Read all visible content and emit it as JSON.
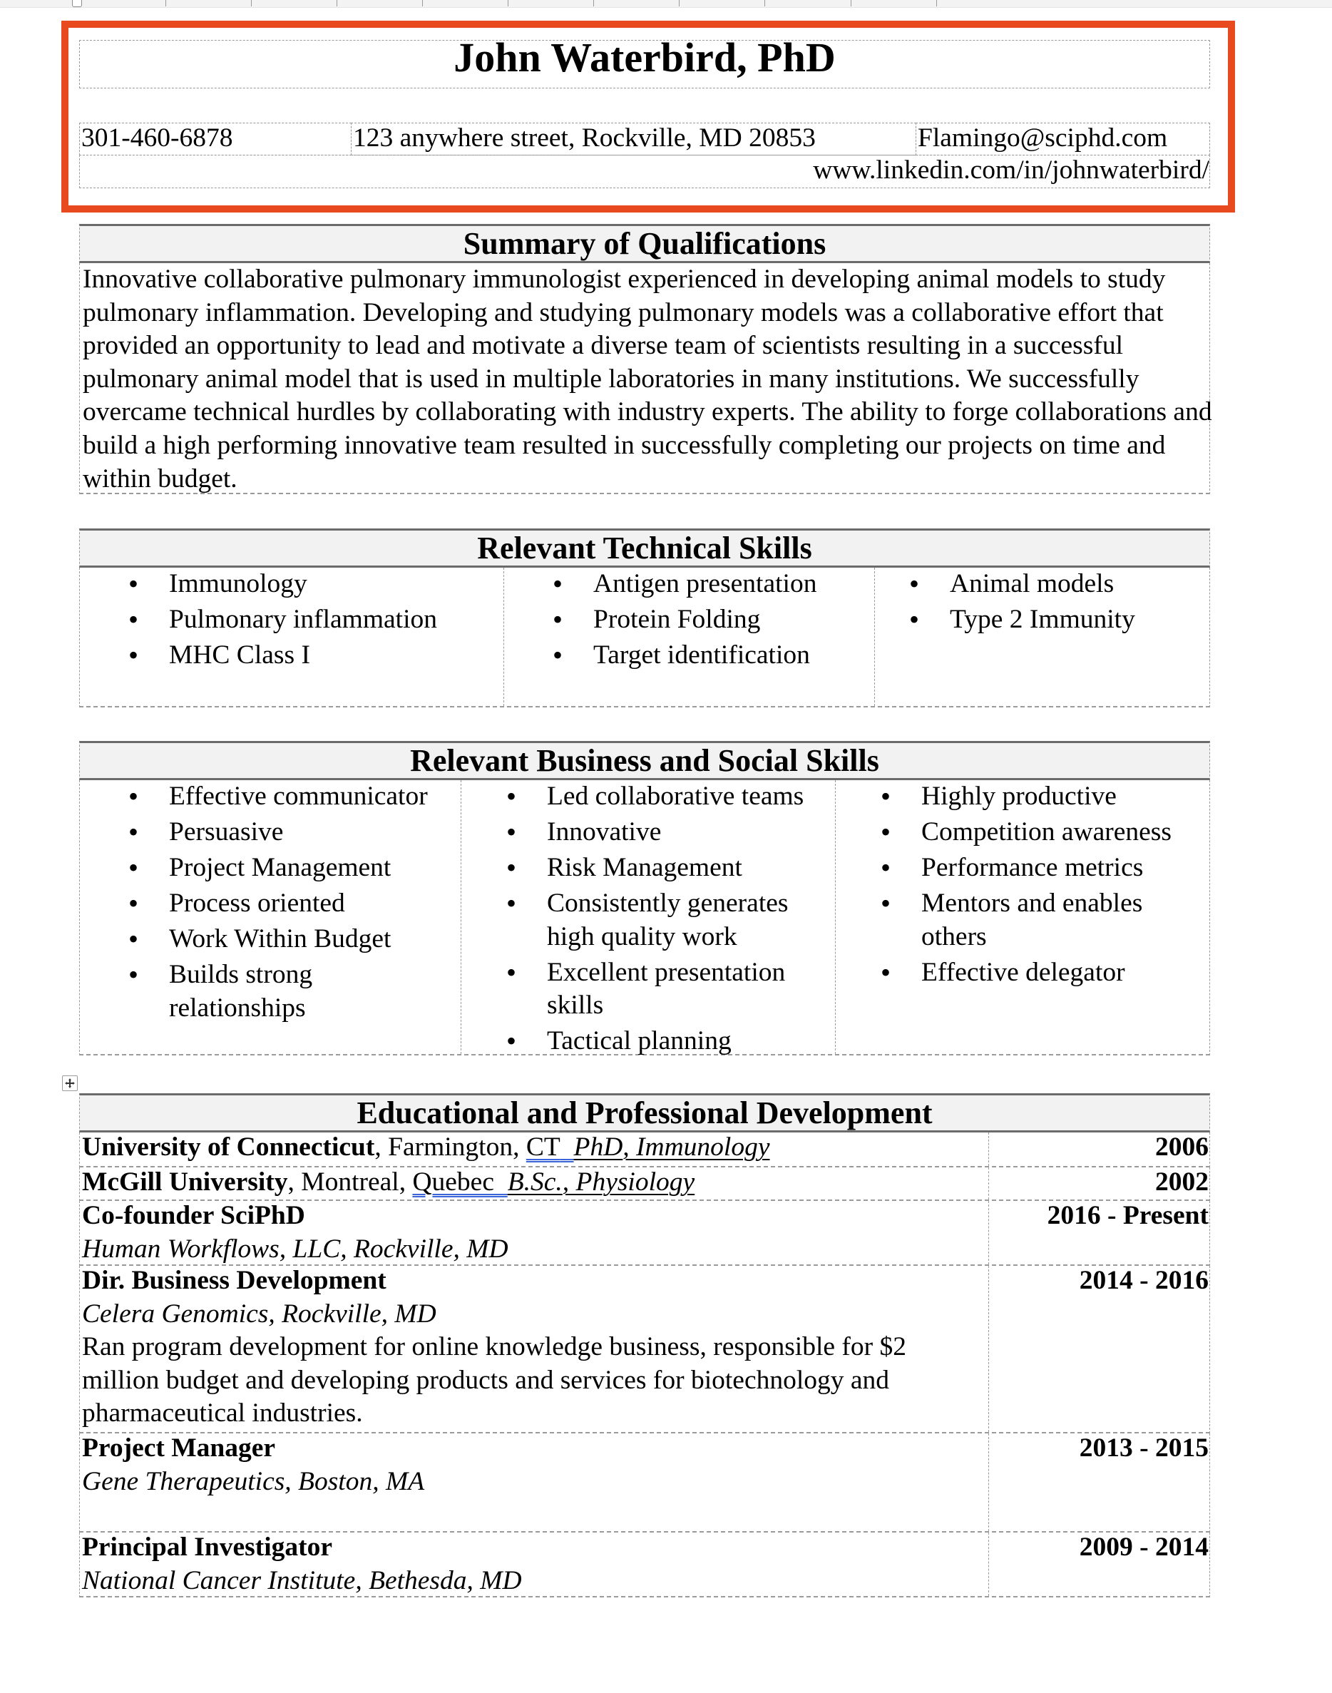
{
  "header": {
    "name": "John Waterbird, PhD",
    "phone": "301-460-6878",
    "address": "123 anywhere street, Rockville, MD 20853",
    "email": "Flamingo@sciphd.com",
    "linkedin": "www.linkedin.com/in/johnwaterbird/"
  },
  "highlight": {
    "color": "#e8491f"
  },
  "summary": {
    "title": "Summary of Qualifications",
    "text": "Innovative collaborative pulmonary immunologist experienced in developing animal models to study pulmonary inflammation. Developing and studying pulmonary models was a collaborative effort that provided an opportunity to lead and motivate a diverse team of scientists resulting in a successful pulmonary animal model that is used in multiple laboratories in many institutions. We successfully overcame technical hurdles by collaborating with industry experts. The ability to forge collaborations and build a high performing innovative team resulted in successfully completing our projects on time and within budget."
  },
  "technical_skills": {
    "title": "Relevant Technical Skills",
    "columns": [
      [
        "Immunology",
        "Pulmonary inflammation",
        "MHC Class I"
      ],
      [
        "Antigen presentation",
        "Protein Folding",
        "Target identification"
      ],
      [
        "Animal models",
        "Type 2 Immunity"
      ]
    ]
  },
  "business_skills": {
    "title": "Relevant Business and Social Skills",
    "columns": [
      [
        "Effective communicator",
        "Persuasive",
        "Project Management",
        "Process oriented",
        "Work Within Budget",
        "Builds strong relationships"
      ],
      [
        "Led collaborative teams",
        "Innovative",
        "Risk Management",
        "Consistently generates high quality work",
        "Excellent presentation skills",
        "Tactical planning"
      ],
      [
        "Highly productive",
        "Competition awareness",
        "Performance metrics",
        "Mentors and enables others",
        "Effective delegator"
      ]
    ]
  },
  "education": {
    "title": "Educational and Professional Development",
    "rows": [
      {
        "institution": "University of Connecticut",
        "location": ", Farmington, ",
        "region": "CT",
        "degree": "PhD",
        "field": ", Immunology",
        "year": "2006"
      },
      {
        "institution": "McGill University",
        "location": ", Montreal, ",
        "region": "Quebec",
        "degree": "B.Sc.",
        "field": ", Physiology",
        "year": "2002"
      }
    ],
    "positions": [
      {
        "title": "Co-founder SciPhD",
        "organization": "Human Workflows, LLC, Rockville, MD",
        "description": "",
        "years": "2016 - Present"
      },
      {
        "title": "Dir. Business Development",
        "organization": "Celera Genomics, Rockville, MD",
        "description": "Ran program development for online knowledge business, responsible for $2 million budget and developing products and services for biotechnology and pharmaceutical industries.",
        "years": "2014 - 2016"
      },
      {
        "title": "Project Manager",
        "organization": "Gene Therapeutics, Boston, MA",
        "description": "",
        "years": "2013 - 2015"
      },
      {
        "title": "Principal Investigator",
        "organization": "National Cancer Institute, Bethesda, MD",
        "description": "",
        "years": "2009 - 2014"
      }
    ]
  },
  "icons": {
    "table_move_handle": "move-arrows-icon"
  }
}
